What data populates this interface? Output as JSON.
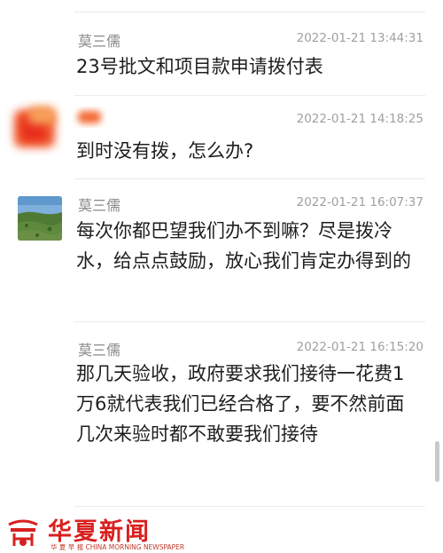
{
  "messages": [
    {
      "name": "莫三儒",
      "time": "2022-01-21 13:44:31",
      "text": "23号批文和项目款申请拨付表"
    },
    {
      "name": "",
      "time": "2022-01-21 14:18:25",
      "text": "到时没有拨，怎么办?"
    },
    {
      "name": "莫三儒",
      "time": "2022-01-21 16:07:37",
      "text": "每次你都巴望我们办不到嘛？尽是拨冷水，给点点鼓励，放心我们肯定办得到的"
    },
    {
      "name": "莫三儒",
      "time": "2022-01-21 16:15:20",
      "text": "那几天验收，政府要求我们接待一花费1万6就代表我们已经合格了，要不然前面几次来验时都不敢要我们接待"
    }
  ],
  "footer": {
    "brand": "华夏新闻",
    "tagline": "华 夏 早 报 CHINA MORNING NEWSPAPER"
  },
  "colors": {
    "brand_red": "#d8201e",
    "text": "#1e1e1e",
    "meta": "#8a8a8a"
  }
}
